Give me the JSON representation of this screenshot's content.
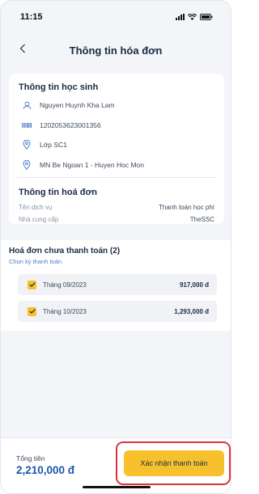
{
  "status_bar": {
    "time": "11:15"
  },
  "header": {
    "title": "Thông tin hóa đơn"
  },
  "student": {
    "section_title": "Thông tin học sinh",
    "name": "Nguyen Huynh Kha Lam",
    "code": "1202053623001356",
    "class": "Lớp SC1",
    "school": "MN Be Ngoan 1 - Huyen Hoc Mon"
  },
  "invoice": {
    "section_title": "Thông tin hoá đơn",
    "service_label": "Tên dịch vụ",
    "service_value": "Thanh toán học phí",
    "provider_label": "Nhà cung cấp",
    "provider_value": "TheSSC"
  },
  "unpaid": {
    "title": "Hoá đơn chưa thanh toán (2)",
    "subtitle": "Chọn kỳ thanh toán",
    "items": [
      {
        "month": "Tháng 09/2023",
        "amount": "917,000 đ",
        "checked": true
      },
      {
        "month": "Tháng 10/2023",
        "amount": "1,293,000 đ",
        "checked": true
      }
    ]
  },
  "footer": {
    "total_label": "Tổng tiền",
    "total_value": "2,210,000 đ",
    "confirm_label": "Xác nhận thanh toán"
  },
  "colors": {
    "accent_yellow": "#f7c12e",
    "total_blue": "#1d57a8",
    "highlight_red": "#d9333f",
    "link_blue": "#4d7fc9"
  }
}
